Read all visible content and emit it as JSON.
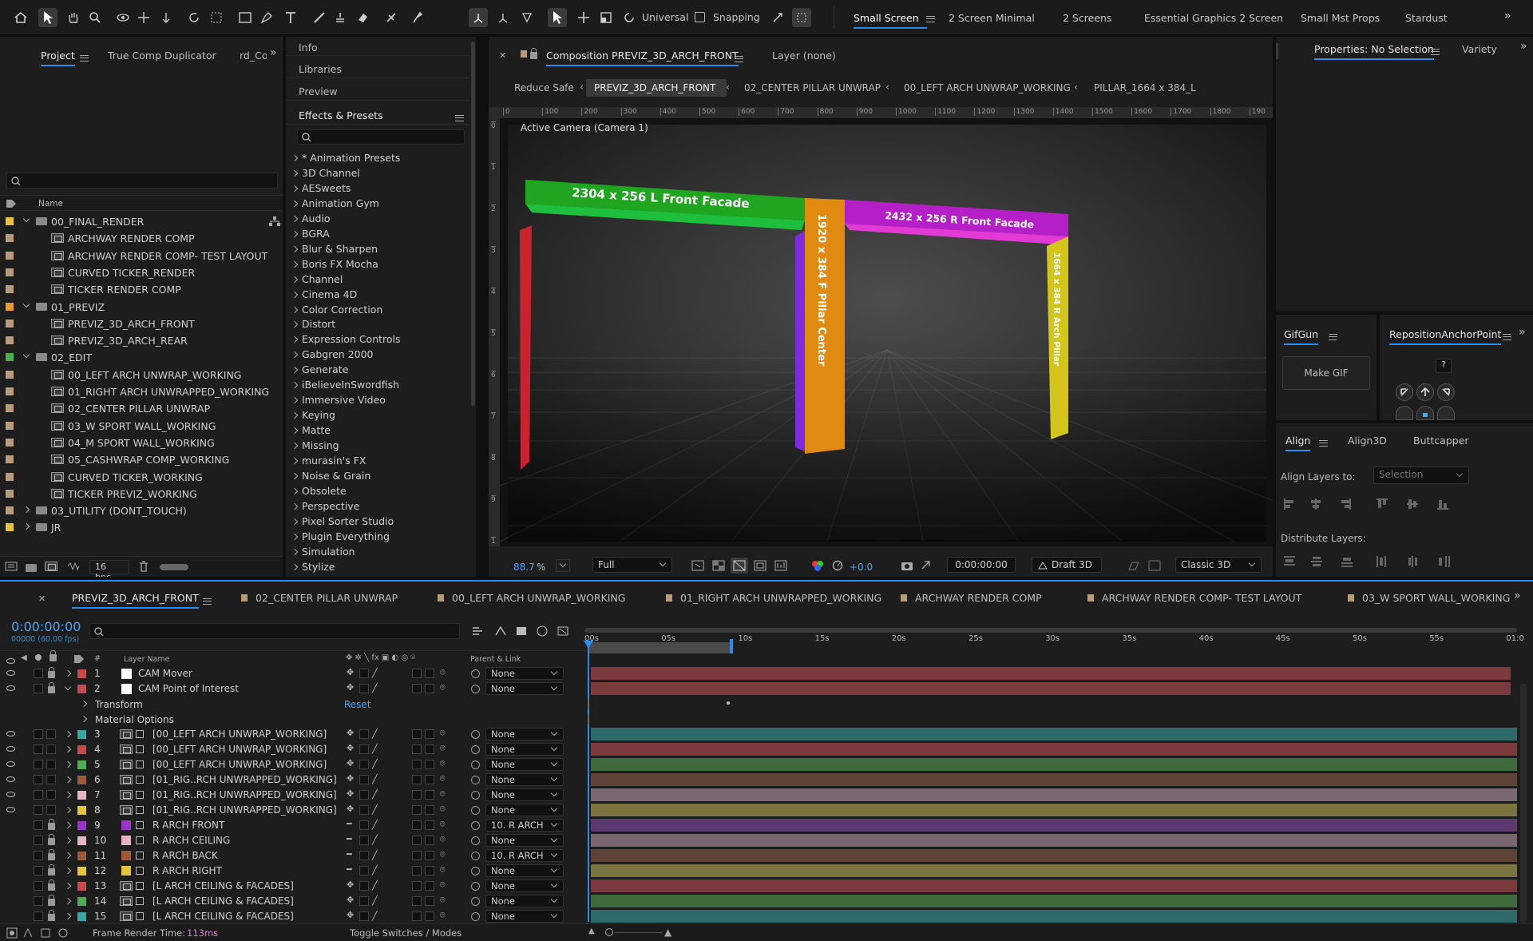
{
  "toolbar": {
    "universal_label": "Universal",
    "snapping_label": "Snapping",
    "workspaces": [
      "Small Screen",
      "2 Screen Minimal",
      "2 Screens",
      "Essential Graphics 2 Screen",
      "Small Mst Props",
      "Stardust"
    ]
  },
  "project": {
    "tabs": [
      "Project",
      "True Comp Duplicator",
      "rd_Co"
    ],
    "column_name": "Name",
    "bpc": "16 bpc",
    "items": [
      {
        "label": "00_FINAL_RENDER",
        "type": "folder",
        "indent": 0,
        "expanded": true,
        "color": "#e8c43b"
      },
      {
        "label": "ARCHWAY RENDER COMP",
        "type": "comp",
        "indent": 1,
        "color": "#b89b7b"
      },
      {
        "label": "ARCHWAY RENDER COMP- TEST LAYOUT",
        "type": "comp",
        "indent": 1,
        "color": "#b89b7b"
      },
      {
        "label": "CURVED TICKER_RENDER",
        "type": "comp",
        "indent": 1,
        "color": "#b89b7b"
      },
      {
        "label": "TICKER RENDER COMP",
        "type": "comp",
        "indent": 1,
        "color": "#b89b7b"
      },
      {
        "label": "01_PREVIZ",
        "type": "folder",
        "indent": 0,
        "expanded": true,
        "color": "#e89a2b"
      },
      {
        "label": "PREVIZ_3D_ARCH_FRONT",
        "type": "comp",
        "indent": 1,
        "color": "#b89b7b"
      },
      {
        "label": "PREVIZ_3D_ARCH_REAR",
        "type": "comp",
        "indent": 1,
        "color": "#b89b7b"
      },
      {
        "label": "02_EDIT",
        "type": "folder",
        "indent": 0,
        "expanded": true,
        "color": "#4caf50"
      },
      {
        "label": "00_LEFT ARCH UNWRAP_WORKING",
        "type": "comp",
        "indent": 1,
        "color": "#b89b7b"
      },
      {
        "label": "01_RIGHT ARCH UNWRAPPED_WORKING",
        "type": "comp",
        "indent": 1,
        "color": "#b89b7b"
      },
      {
        "label": "02_CENTER PILLAR UNWRAP",
        "type": "comp",
        "indent": 1,
        "color": "#b89b7b"
      },
      {
        "label": "03_W SPORT WALL_WORKING",
        "type": "comp",
        "indent": 1,
        "color": "#b89b7b"
      },
      {
        "label": "04_M SPORT WALL_WORKING",
        "type": "comp",
        "indent": 1,
        "color": "#b89b7b"
      },
      {
        "label": "05_CASHWRAP COMP_WORKING",
        "type": "comp",
        "indent": 1,
        "color": "#b89b7b"
      },
      {
        "label": "CURVED TICKER_WORKING",
        "type": "comp",
        "indent": 1,
        "color": "#b89b7b"
      },
      {
        "label": "TICKER PREVIZ_WORKING",
        "type": "comp",
        "indent": 1,
        "color": "#b89b7b"
      },
      {
        "label": "03_UTILITY (DONT_TOUCH)",
        "type": "folder",
        "indent": 0,
        "expanded": false,
        "color": "#b89b7b"
      },
      {
        "label": "JR",
        "type": "folder",
        "indent": 0,
        "expanded": false,
        "color": "#e8c43b"
      }
    ]
  },
  "effects": {
    "top_items": [
      "Info",
      "Libraries",
      "Preview"
    ],
    "panel_title": "Effects & Presets",
    "items": [
      "* Animation Presets",
      "3D Channel",
      "AESweets",
      "Animation Gym",
      "Audio",
      "BGRA",
      "Blur & Sharpen",
      "Boris FX Mocha",
      "Channel",
      "Cinema 4D",
      "Color Correction",
      "Distort",
      "Expression Controls",
      "Gabgren 2000",
      "Generate",
      "iBelieveInSwordfish",
      "Immersive Video",
      "Keying",
      "Matte",
      "Missing",
      "murasin's FX",
      "Noise & Grain",
      "Obsolete",
      "Perspective",
      "Pixel Sorter Studio",
      "Plugin Everything",
      "Simulation",
      "Stylize"
    ]
  },
  "viewer": {
    "comp_tab": "Composition PREVIZ_3D_ARCH_FRONT",
    "layer_tab": "Layer (none)",
    "breadcrumbs": [
      "Reduce Safe",
      "PREVIZ_3D_ARCH_FRONT",
      "02_CENTER PILLAR UNWRAP",
      "00_LEFT ARCH UNWRAP_WORKING",
      "PILLAR_1664 x 384_L"
    ],
    "camera_label": "Active Camera (Camera 1)",
    "ruler_labels": [
      "0",
      "100",
      "200",
      "300",
      "400",
      "500",
      "600",
      "700",
      "800",
      "900",
      "1000",
      "1100",
      "1200",
      "1300",
      "1400",
      "1500",
      "1600",
      "1700",
      "1800",
      "190"
    ],
    "vruler_labels": [
      "0",
      "1",
      "2",
      "3",
      "4",
      "5",
      "6",
      "7",
      "8",
      "9",
      "1"
    ],
    "scene": {
      "left_facade": "2304 x 256 L Front Facade",
      "right_facade": "2432 x 256 R Front Facade",
      "center_pillar": "1920 x 384 F Pillar Center",
      "right_pillar": "1664 x 384 R Arch Pillar"
    },
    "zoom": "88.7",
    "zoom_unit": "%",
    "resolution": "Full",
    "exposure": "+0.0",
    "timecode": "0:00:00:00",
    "draft": "Draft 3D",
    "renderer": "Classic 3D"
  },
  "right_panel": {
    "properties_tab": "Properties: No Selection",
    "variety_tab": "Variety",
    "gifgun_tab": "GifGun",
    "make_gif": "Make GIF",
    "reposition_tab": "RepositionAnchorPoint",
    "help": "?",
    "align_tabs": [
      "Align",
      "Align3D",
      "Buttcapper"
    ],
    "align_to_label": "Align Layers to:",
    "align_to_value": "Selection",
    "distribute_label": "Distribute Layers:"
  },
  "timeline": {
    "tabs": [
      "PREVIZ_3D_ARCH_FRONT",
      "02_CENTER PILLAR UNWRAP",
      "00_LEFT ARCH UNWRAP_WORKING",
      "01_RIGHT ARCH UNWRAPPED_WORKING",
      "ARCHWAY RENDER COMP",
      "ARCHWAY RENDER COMP- TEST LAYOUT",
      "03_W SPORT WALL_WORKING"
    ],
    "timecode": "0:00:00:00",
    "fps": "00000 (60.00 fps)",
    "col_layer_name": "Layer Name",
    "col_parent": "Parent & Link",
    "col_num": "#",
    "ruler": [
      "00s",
      "05s",
      "10s",
      "15s",
      "20s",
      "25s",
      "30s",
      "35s",
      "40s",
      "45s",
      "50s",
      "55s",
      "01:0"
    ],
    "layers": [
      {
        "num": "1",
        "name": "CAM Mover",
        "color": "#c94a4a",
        "type": "null",
        "parent": "None",
        "bar": "#7a3a3e",
        "eye": true,
        "lock": true
      },
      {
        "num": "2",
        "name": "CAM Point of Interest",
        "color": "#c94a4a",
        "type": "null",
        "parent": "None",
        "bar": "#7a3a3e",
        "eye": true,
        "lock": true,
        "expanded": true
      },
      {
        "sub": "Transform",
        "reset": "Reset"
      },
      {
        "sub": "Material Options"
      },
      {
        "num": "3",
        "name": "[00_LEFT ARCH UNWRAP_WORKING]",
        "color": "#3aa5a5",
        "type": "comp",
        "parent": "None",
        "bar": "#2f6a6a",
        "eye": true
      },
      {
        "num": "4",
        "name": "[00_LEFT ARCH UNWRAP_WORKING]",
        "color": "#c94a4a",
        "type": "comp",
        "parent": "None",
        "bar": "#7a3a3e",
        "eye": true
      },
      {
        "num": "5",
        "name": "[00_LEFT ARCH UNWRAP_WORKING]",
        "color": "#4caf50",
        "type": "comp",
        "parent": "None",
        "bar": "#3e6a3e",
        "eye": true
      },
      {
        "num": "6",
        "name": "[01_RIG..RCH UNWRAPPED_WORKING]",
        "color": "#9c5a3a",
        "type": "comp",
        "parent": "None",
        "bar": "#5e4438",
        "eye": true
      },
      {
        "num": "7",
        "name": "[01_RIG..RCH UNWRAPPED_WORKING]",
        "color": "#e8b4c4",
        "type": "comp",
        "parent": "None",
        "bar": "#7a6870",
        "eye": true
      },
      {
        "num": "8",
        "name": "[01_RIG..RCH UNWRAPPED_WORKING]",
        "color": "#e8c43b",
        "type": "comp",
        "parent": "None",
        "bar": "#7a7440",
        "eye": true
      },
      {
        "num": "9",
        "name": "R ARCH FRONT",
        "color": "#9b34c9",
        "type": "solid",
        "parent": "10. R ARCH",
        "bar": "#5c3a70",
        "eye": false,
        "lock": true
      },
      {
        "num": "10",
        "name": "R ARCH CEILING",
        "color": "#e8b4c4",
        "type": "solid",
        "parent": "None",
        "bar": "#7a6870",
        "eye": false,
        "lock": true
      },
      {
        "num": "11",
        "name": "R ARCH BACK",
        "color": "#9c5a3a",
        "type": "solid",
        "parent": "10. R ARCH",
        "bar": "#5e4438",
        "eye": false,
        "lock": true
      },
      {
        "num": "12",
        "name": "R ARCH RIGHT",
        "color": "#e8c43b",
        "type": "solid",
        "parent": "None",
        "bar": "#7a7440",
        "eye": false,
        "lock": true
      },
      {
        "num": "13",
        "name": "[L ARCH CEILING & FACADES]",
        "color": "#c94a4a",
        "type": "comp",
        "parent": "None",
        "bar": "#7a3a3e",
        "eye": false,
        "lock": true
      },
      {
        "num": "14",
        "name": "[L ARCH CEILING & FACADES]",
        "color": "#4caf50",
        "type": "comp",
        "parent": "None",
        "bar": "#3e6a3e",
        "eye": false,
        "lock": true
      },
      {
        "num": "15",
        "name": "[L ARCH CEILING & FACADES]",
        "color": "#3aa5a5",
        "type": "comp",
        "parent": "None",
        "bar": "#2f6a6a",
        "eye": false,
        "lock": true
      }
    ],
    "frame_render_label": "Frame Render Time:",
    "frame_render_value": "113ms",
    "toggle_label": "Toggle Switches / Modes"
  }
}
